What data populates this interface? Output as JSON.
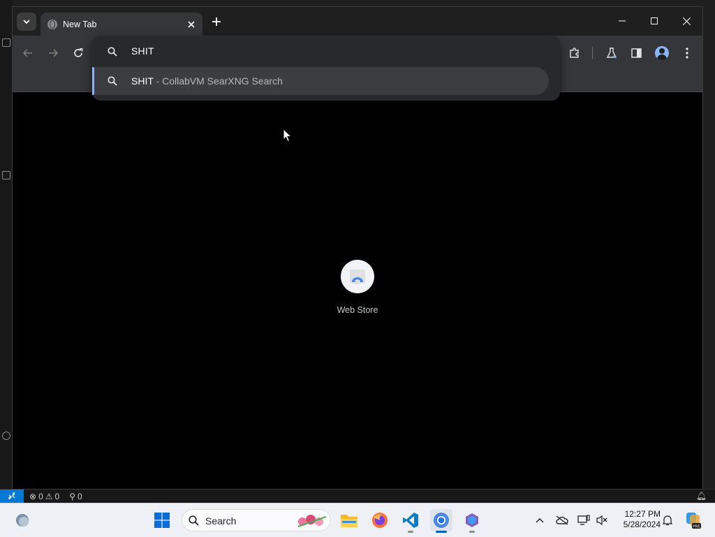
{
  "vscode": {
    "status": {
      "errors": "0",
      "warnings": "0",
      "ports": "0"
    }
  },
  "browser": {
    "tab": {
      "title": "New Tab"
    },
    "omnibox": {
      "input_value": "SHIT",
      "suggestion": {
        "query": "SHIT",
        "separator": " - ",
        "description": "CollabVM SearXNG Search"
      }
    },
    "ntp": {
      "shortcuts": [
        {
          "label": "Web Store"
        }
      ]
    }
  },
  "taskbar": {
    "search_label": "Search",
    "clock": {
      "time": "12:27 PM",
      "date": "5/28/2024"
    }
  },
  "colors": {
    "accent": "#8ab4f8",
    "vscode_remote": "#0078d4",
    "taskbar_active": "#005fb8"
  }
}
